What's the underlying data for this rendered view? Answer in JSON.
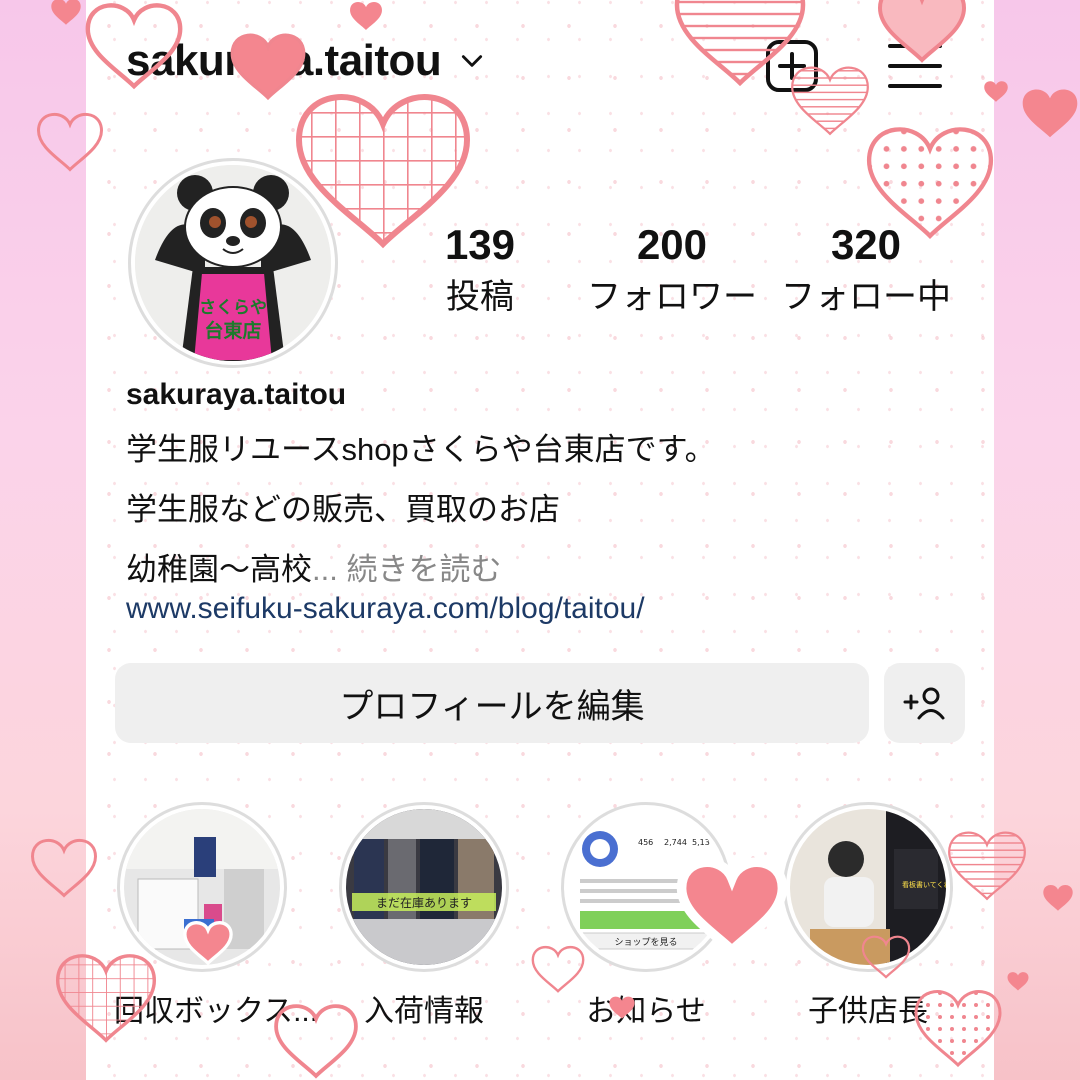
{
  "profile": {
    "username": "sakuraya.taitou",
    "display_name": "sakuraya.taitou",
    "bio_line1": "学生服リユースshopさくらや台東店です。",
    "bio_line2": "学生服などの販売、買取のお店",
    "bio_line3": "幼稚園〜高校",
    "bio_ellipsis": "...",
    "read_more": "続きを読む",
    "link": "www.seifuku-sakuraya.com/blog/taitou/",
    "avatar_sign_line1": "さくらや",
    "avatar_sign_line2": "台東店"
  },
  "stats": [
    {
      "value": "139",
      "label": "投稿"
    },
    {
      "value": "200",
      "label": "フォロワー"
    },
    {
      "value": "320",
      "label": "フォロー中"
    }
  ],
  "buttons": {
    "edit_profile": "プロフィールを編集"
  },
  "highlights": [
    {
      "label": "回収ボックス..."
    },
    {
      "label": "入荷情報",
      "overlay_text": "まだ在庫あります"
    },
    {
      "label": "お知らせ",
      "mini_stats": [
        "456",
        "2,744",
        "5,13"
      ],
      "mini_button": "ショップを見る"
    },
    {
      "label": "子供店長",
      "overlay_text": "看板書いてくれたよ"
    }
  ],
  "icons": [
    "chevron-down-icon",
    "new-post-icon",
    "menu-icon",
    "add-user-icon"
  ],
  "colors": {
    "heart_pink": "#f4868f",
    "heart_light": "#f9b9bf",
    "link": "#1d3a66",
    "button_bg": "#efefef"
  }
}
